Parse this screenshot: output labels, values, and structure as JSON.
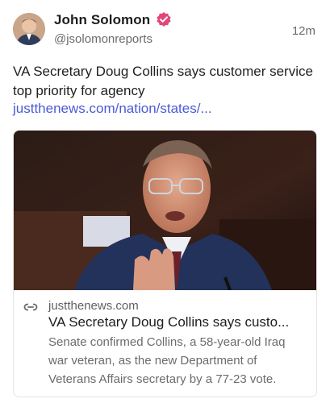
{
  "author": {
    "name": "John Solomon",
    "handle": "@jsolomonreports",
    "verified_icon": "verified-badge-icon",
    "badge_color": "#e0457b"
  },
  "post": {
    "timestamp": "12m",
    "text": "VA Secretary Doug Collins says customer service top priority for agency",
    "link": "justthenews.com/nation/states/..."
  },
  "card": {
    "icon": "link-icon",
    "domain": "justthenews.com",
    "title": "VA Secretary Doug Collins says custo...",
    "description": "Senate confirmed Collins, a 58-year-old Iraq war veteran, as the new Department of Veterans Affairs secretary by a 77-23 vote."
  },
  "colors": {
    "link": "#4b5bd6",
    "secondary_text": "#6b6b70",
    "border": "#e4e4e7"
  }
}
